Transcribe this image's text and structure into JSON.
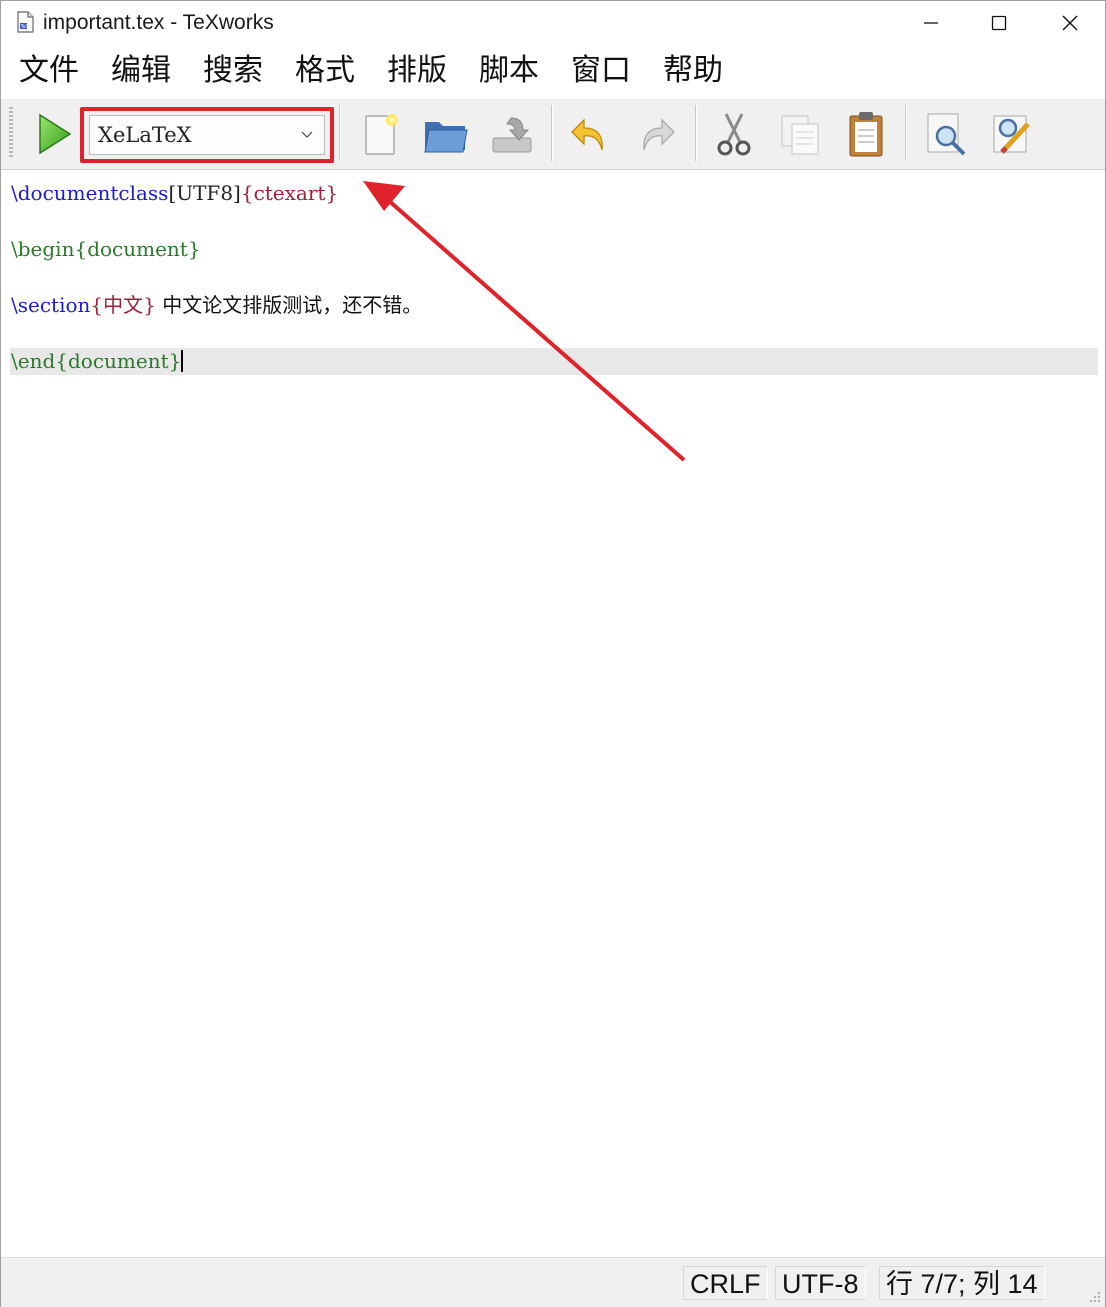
{
  "window": {
    "title": "important.tex - TeXworks",
    "controls": {
      "minimize": "minimize",
      "maximize": "maximize",
      "close": "close"
    }
  },
  "menu": {
    "items": [
      {
        "label": "文件"
      },
      {
        "label": "编辑"
      },
      {
        "label": "搜索"
      },
      {
        "label": "格式"
      },
      {
        "label": "排版"
      },
      {
        "label": "脚本"
      },
      {
        "label": "窗口"
      },
      {
        "label": "帮助"
      }
    ]
  },
  "toolbar": {
    "engine_selected": "XeLaTeX",
    "buttons": [
      "typeset-icon",
      "new-document-icon",
      "open-folder-icon",
      "save-icon",
      "undo-icon",
      "redo-icon",
      "cut-icon",
      "copy-icon",
      "paste-icon",
      "find-icon",
      "replace-icon"
    ],
    "highlight_color": "#e0222a"
  },
  "editor": {
    "lines": [
      {
        "cmd": "\\documentclass",
        "opt": "[UTF8]",
        "arg": "{ctexart}"
      },
      {
        "cmd": "\\begin",
        "arg": "{document}"
      },
      {
        "cmd": "\\section",
        "arg": "{中文}",
        "text": " 中文论文排版测试，还不错。"
      },
      {
        "cmd": "\\end",
        "arg": "{document}"
      }
    ],
    "colors": {
      "command": "#1c1ccc",
      "group": "#2a7a2a",
      "class_arg": "#a0203a"
    }
  },
  "status": {
    "line_ending": "CRLF",
    "encoding": "UTF-8",
    "position": "行 7/7; 列 14"
  },
  "annotation": {
    "arrow_color": "#e0222a"
  }
}
